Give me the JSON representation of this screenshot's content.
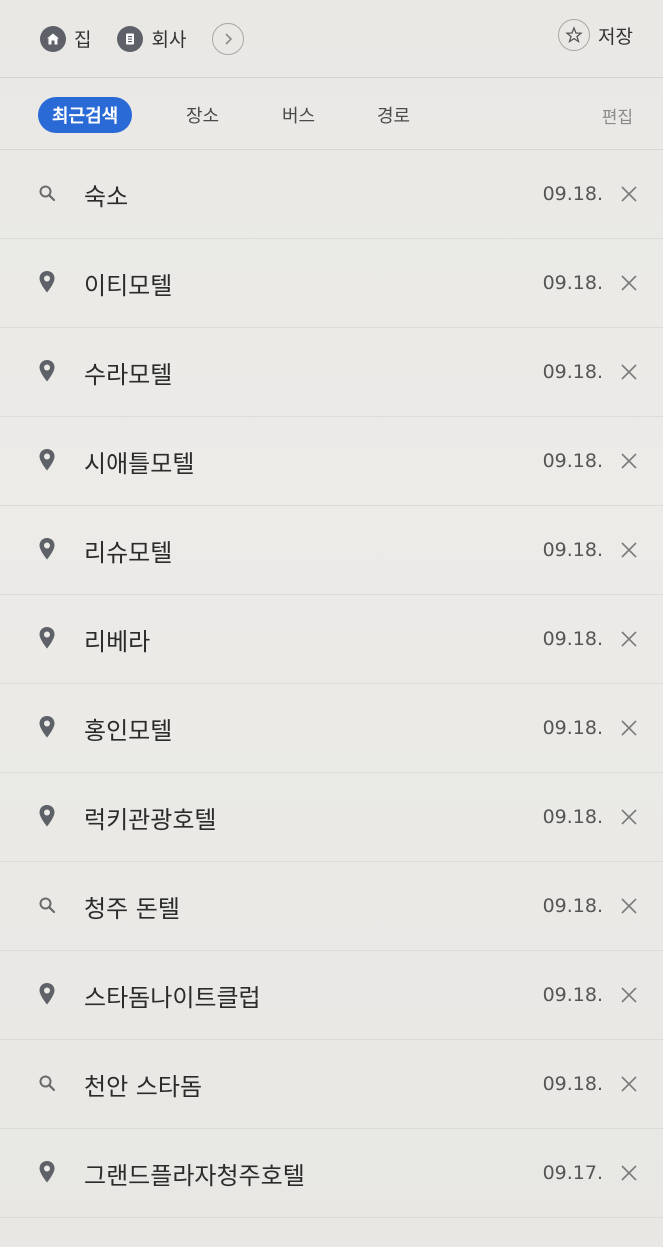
{
  "shortcuts": {
    "home_label": "집",
    "work_label": "회사",
    "save_label": "저장"
  },
  "tabs": [
    {
      "label": "최근검색",
      "active": true
    },
    {
      "label": "장소",
      "active": false
    },
    {
      "label": "버스",
      "active": false
    },
    {
      "label": "경로",
      "active": false
    }
  ],
  "edit_label": "편집",
  "recent": [
    {
      "icon": "search-icon",
      "name": "숙소",
      "date": "09.18."
    },
    {
      "icon": "place-pin-icon",
      "name": "이티모텔",
      "date": "09.18."
    },
    {
      "icon": "place-pin-icon",
      "name": "수라모텔",
      "date": "09.18."
    },
    {
      "icon": "place-pin-icon",
      "name": "시애틀모텔",
      "date": "09.18."
    },
    {
      "icon": "place-pin-icon",
      "name": "리슈모텔",
      "date": "09.18."
    },
    {
      "icon": "place-pin-icon",
      "name": "리베라",
      "date": "09.18."
    },
    {
      "icon": "place-pin-icon",
      "name": "홍인모텔",
      "date": "09.18."
    },
    {
      "icon": "place-pin-icon",
      "name": "럭키관광호텔",
      "date": "09.18."
    },
    {
      "icon": "search-icon",
      "name": "청주 돈텔",
      "date": "09.18."
    },
    {
      "icon": "place-pin-icon",
      "name": "스타돔나이트클럽",
      "date": "09.18."
    },
    {
      "icon": "search-icon",
      "name": "천안 스타돔",
      "date": "09.18."
    },
    {
      "icon": "place-pin-icon",
      "name": "그랜드플라자청주호텔",
      "date": "09.17."
    }
  ],
  "colors": {
    "accent": "#2a6ad6",
    "icon_gray": "#5e6167",
    "background": "#ecebe8"
  }
}
